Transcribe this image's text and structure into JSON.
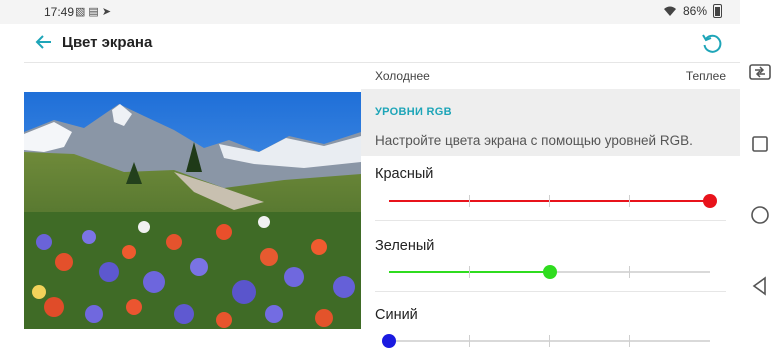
{
  "status_bar": {
    "time": "17:49",
    "battery": "86%",
    "icons": [
      "image-icon",
      "box-icon",
      "navigation-icon",
      "wifi-icon",
      "battery-icon"
    ]
  },
  "app_bar": {
    "title": "Цвет экрана",
    "back_icon": "arrow-back-icon",
    "reset_icon": "reset-icon"
  },
  "color_temperature": {
    "cold_label": "Холоднее",
    "warm_label": "Теплее"
  },
  "rgb": {
    "header": "УРОВНИ RGB",
    "description": "Настройте цвета экрана с помощью уровней RGB.",
    "sliders": [
      {
        "label": "Красный",
        "value": 1.0,
        "color": "#e8131b"
      },
      {
        "label": "Зеленый",
        "value": 0.5,
        "color": "#2fdc1f"
      },
      {
        "label": "Синий",
        "value": 0.0,
        "color": "#1a1ae0"
      }
    ]
  },
  "accent_color": "#1ea5b8",
  "nav_bar": {
    "icons": [
      "swap-screen-icon",
      "recents-square-icon",
      "home-circle-icon",
      "back-triangle-icon"
    ]
  }
}
